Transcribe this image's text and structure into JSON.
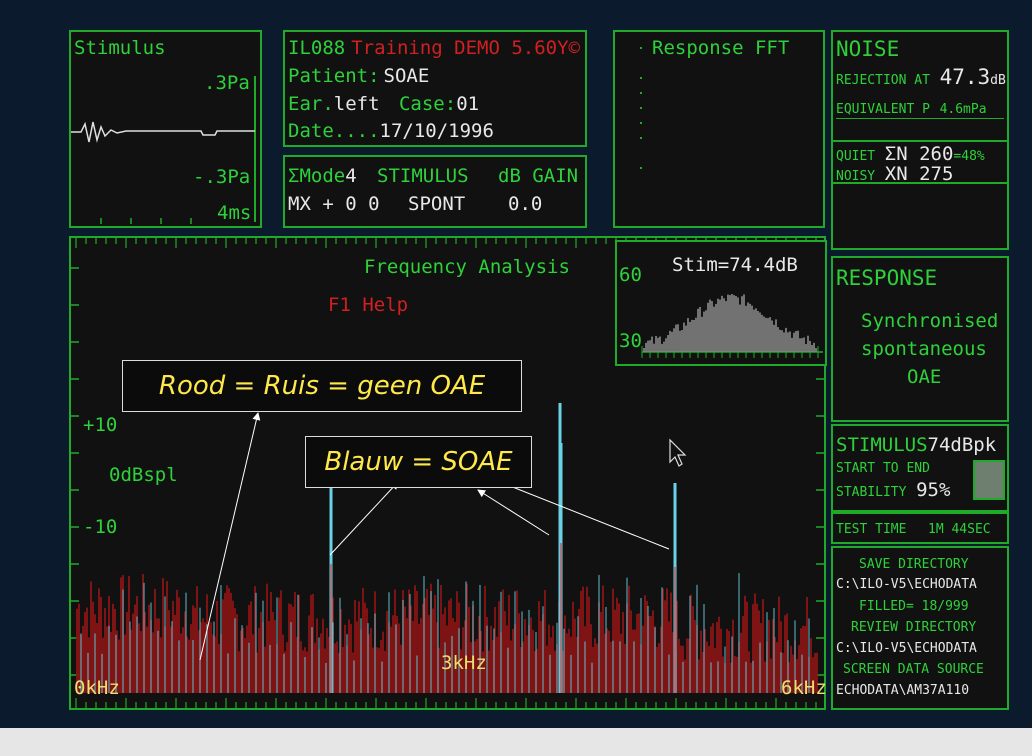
{
  "stimulus_panel": {
    "title": "Stimulus",
    "scale_top": ".3Pa",
    "scale_bottom": "-.3Pa",
    "time": "4ms"
  },
  "info_panel": {
    "line1_model": "IL088",
    "line1_product": "Training DEMO 5.60Y©",
    "patient_label": "Patient:",
    "patient_value": "SOAE",
    "ear_label": "Ear.",
    "ear_value": "left",
    "case_label": "Case:",
    "case_value": "01",
    "date_label": "Date....",
    "date_value": "17/10/1996"
  },
  "mode_panel": {
    "mode_label": "ΣMode",
    "mode_value": "4",
    "stimulus_header": "STIMULUS",
    "gain_header": "dB GAIN",
    "mx_label": "MX + 0 0",
    "stimulus_value": "SPONT",
    "gain_value": "0.0"
  },
  "response_fft_panel": {
    "title": "Response FFT"
  },
  "noise_panel": {
    "title": "NOISE",
    "rejection_label": "REJECTION AT",
    "rejection_value": "47.3",
    "rejection_unit": "dB",
    "equivalent_label": "EQUIVALENT P",
    "equivalent_value": "4.6mPa"
  },
  "quiet_panel": {
    "quiet_label": "QUIET",
    "quiet_value": "ΣN 260",
    "quiet_pct": "=48%",
    "noisy_label": "NOISY",
    "noisy_value": "XN 275"
  },
  "freq_panel": {
    "title": "Frequency Analysis",
    "help": "F1 Help",
    "y_plus10": "+10",
    "y_0": "0dBspl",
    "y_minus10": "-10",
    "x_start": "0kHz",
    "x_mid": "3kHz",
    "x_end": "6kHz"
  },
  "stim_spectrum": {
    "title": "Stim=74.4dB",
    "y_top": "60",
    "y_bottom": "30"
  },
  "response_panel": {
    "title": "RESPONSE",
    "line1": "Synchronised",
    "line2": "spontaneous",
    "line3": "OAE"
  },
  "stim_stability_panel": {
    "stimulus_label": "STIMULUS",
    "stimulus_value": "74dBpk",
    "start_end": "START TO END",
    "stability_label": "STABILITY",
    "stability_value": "95%"
  },
  "test_time_panel": {
    "label": "TEST TIME",
    "value": "1M 44SEC"
  },
  "directory_panel": {
    "save_dir_label": "SAVE DIRECTORY",
    "save_dir_value": "C:\\ILO-V5\\ECHODATA",
    "filled": "FILLED= 18/999",
    "review_dir_label": "REVIEW DIRECTORY",
    "review_dir_value": "C:\\ILO-V5\\ECHODATA",
    "screen_source_label": "SCREEN DATA SOURCE",
    "screen_source_value": "ECHODATA\\AM37A110"
  },
  "annotations": {
    "red_callout": "Rood = Ruis = geen OAE",
    "blue_callout": "Blauw = SOAE"
  },
  "colors": {
    "frame_green": "#1faa2a",
    "text_green": "#2ed13a",
    "noise_red": "#a01818",
    "soae_cyan": "#6ad2e6",
    "callout_yellow": "#ffe84a"
  }
}
